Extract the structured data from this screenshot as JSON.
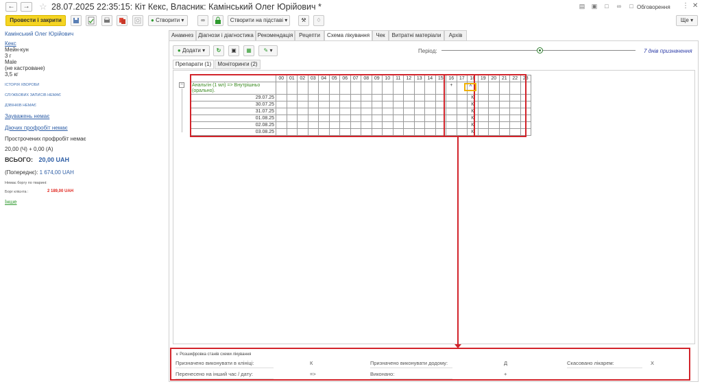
{
  "window": {
    "title": "28.07.2025 22:35:15: Кіт Кекс, Власник: Камінський Олег Юрійович *",
    "discuss_label": "Обговорення",
    "more_label": "Ще"
  },
  "toolbar": {
    "post_close": "Провести і закрити",
    "create": "Створити",
    "create_based": "Створити на підставі"
  },
  "sidebar": {
    "owner": "Камінський Олег Юрійович",
    "pet_name": "Кекс",
    "breed": "Мейн-кун",
    "age": "3 г",
    "sex": "Male",
    "neutered": "(не кастроване)",
    "weight": "3,5 кг",
    "history": "ІСТОРІЯ ХВОРОБИ",
    "service_records": "СЛУЖБОВИХ ЗАПИСІВ НЕМАЄ",
    "calls": "ДЗВІНКІВ НЕМАЄ",
    "remarks": "Зауважень немає",
    "active_prophylaxis": "Діючих профробіт немає",
    "overdue": "Прострочених профробіт немає",
    "sum_line": "20,00 (Ч) + 0,00 (А)",
    "total_label": "ВСЬОГО:",
    "total_value": "20,00 UAH",
    "previous_label": "(Попереднє):",
    "previous_value": "1 674,00 UAH",
    "no_debt": "Немає боргу по тварині:",
    "client_debt_label": "Борг клієнта :",
    "client_debt_value": "2 189,00 UAH",
    "other": "Інше",
    "debt_color": "#e0241c"
  },
  "tabs": [
    "Анамнез",
    "Діагнози і діагностика",
    "Рекомендація",
    "Рецепти",
    "Схема лікування",
    "Чек",
    "Витратні матеріали",
    "Архів"
  ],
  "active_tab": "Схема лікування",
  "content_toolbar": {
    "add_label": "Додати",
    "period_label": "Період:",
    "days_label": "7 днів призначення"
  },
  "subtabs": [
    "Препарати (1)",
    "Моніторинги (2)"
  ],
  "schedule": {
    "hours": [
      "00",
      "01",
      "02",
      "03",
      "04",
      "05",
      "06",
      "07",
      "08",
      "09",
      "10",
      "11",
      "12",
      "13",
      "14",
      "15",
      "16",
      "17",
      "18",
      "19",
      "20",
      "21",
      "22",
      "23"
    ],
    "drug": "Анальгін (1 мл) => Внутрішньо (орально).",
    "drug_row_marks": {
      "16": "+",
      "18": "Х ▾"
    },
    "dates": [
      "29.07.25",
      "30.07.25",
      "31.07.25",
      "01.08.25",
      "02.08.25",
      "03.08.25"
    ],
    "date_mark_hour": "18",
    "date_mark": "К"
  },
  "legend": {
    "title": "Розшифровка станів схеми лікування",
    "items": [
      {
        "label": "Призначено виконувати в клініці:",
        "code": "К"
      },
      {
        "label": "Призначено виконувати додому:",
        "code": "Д"
      },
      {
        "label": "Скасовано лікарем:",
        "code": "Х"
      },
      {
        "label": "Перенесено на інший час / дату:",
        "code": "=>"
      },
      {
        "label": "Виконано:",
        "code": "+"
      }
    ]
  }
}
